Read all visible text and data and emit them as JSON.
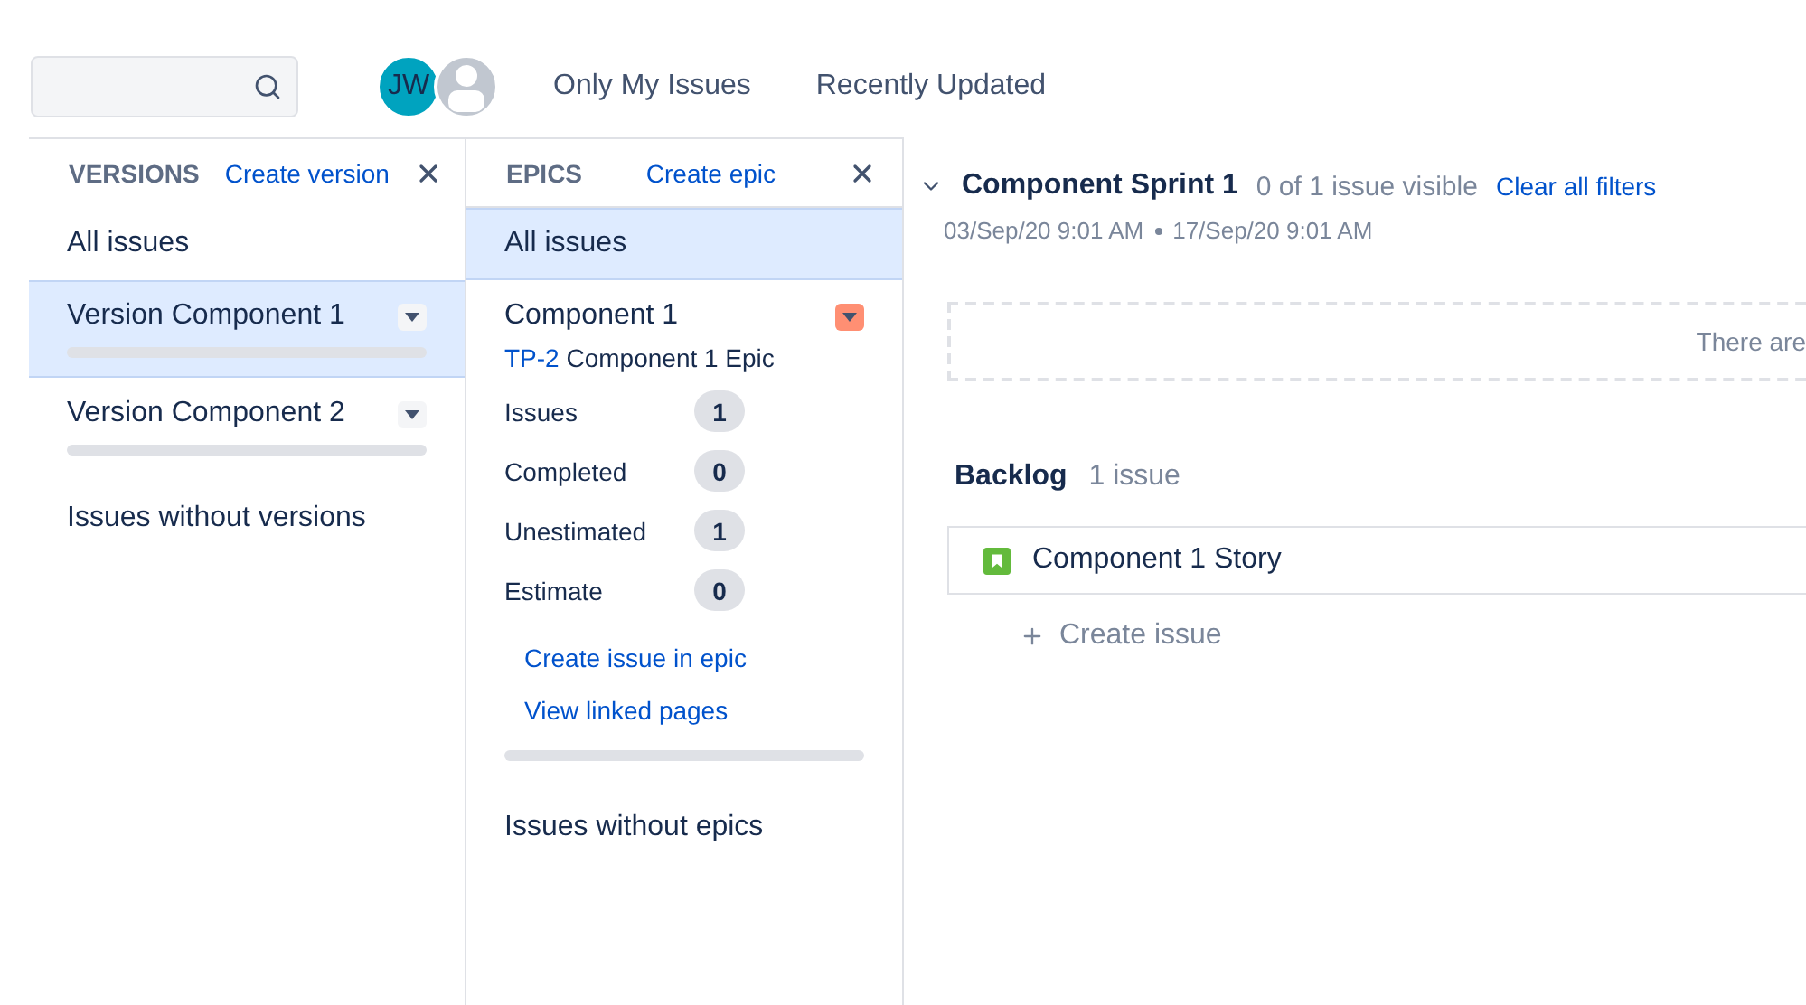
{
  "toolbar": {
    "avatars": [
      {
        "kind": "initials",
        "initials": "JW"
      },
      {
        "kind": "generic"
      }
    ],
    "quick_filters": [
      "Only My Issues",
      "Recently Updated"
    ]
  },
  "versions": {
    "title": "VERSIONS",
    "create_link": "Create version",
    "items": [
      {
        "kind": "filter",
        "label": "All issues",
        "selected": false
      },
      {
        "kind": "version",
        "label": "Version Component 1",
        "selected": true
      },
      {
        "kind": "version",
        "label": "Version Component 2",
        "selected": false
      },
      {
        "kind": "filter",
        "label": "Issues without versions",
        "selected": false
      }
    ]
  },
  "epics": {
    "title": "EPICS",
    "create_link": "Create epic",
    "items": [
      {
        "kind": "filter",
        "label": "All issues",
        "selected": true
      },
      {
        "kind": "epic",
        "label": "Component 1",
        "selected": false,
        "color": "#ff8f73",
        "key": "TP-2",
        "summary": "Component 1 Epic",
        "stats": [
          {
            "label": "Issues",
            "value": "1"
          },
          {
            "label": "Completed",
            "value": "0"
          },
          {
            "label": "Unestimated",
            "value": "1"
          },
          {
            "label": "Estimate",
            "value": "0"
          }
        ],
        "links": [
          "Create issue in epic",
          "View linked pages"
        ]
      },
      {
        "kind": "filter",
        "label": "Issues without epics",
        "selected": false
      }
    ]
  },
  "sprint": {
    "name": "Component Sprint 1",
    "expanded": true,
    "visibility": "0 of 1 issue visible",
    "clear_link": "Clear all filters",
    "start": "03/Sep/20 9:01 AM",
    "end": "17/Sep/20 9:01 AM",
    "empty_message": "There are"
  },
  "backlog": {
    "title": "Backlog",
    "count": "1 issue",
    "issues": [
      {
        "kind": "story",
        "summary": "Component 1 Story"
      }
    ],
    "create_label": "Create issue"
  }
}
